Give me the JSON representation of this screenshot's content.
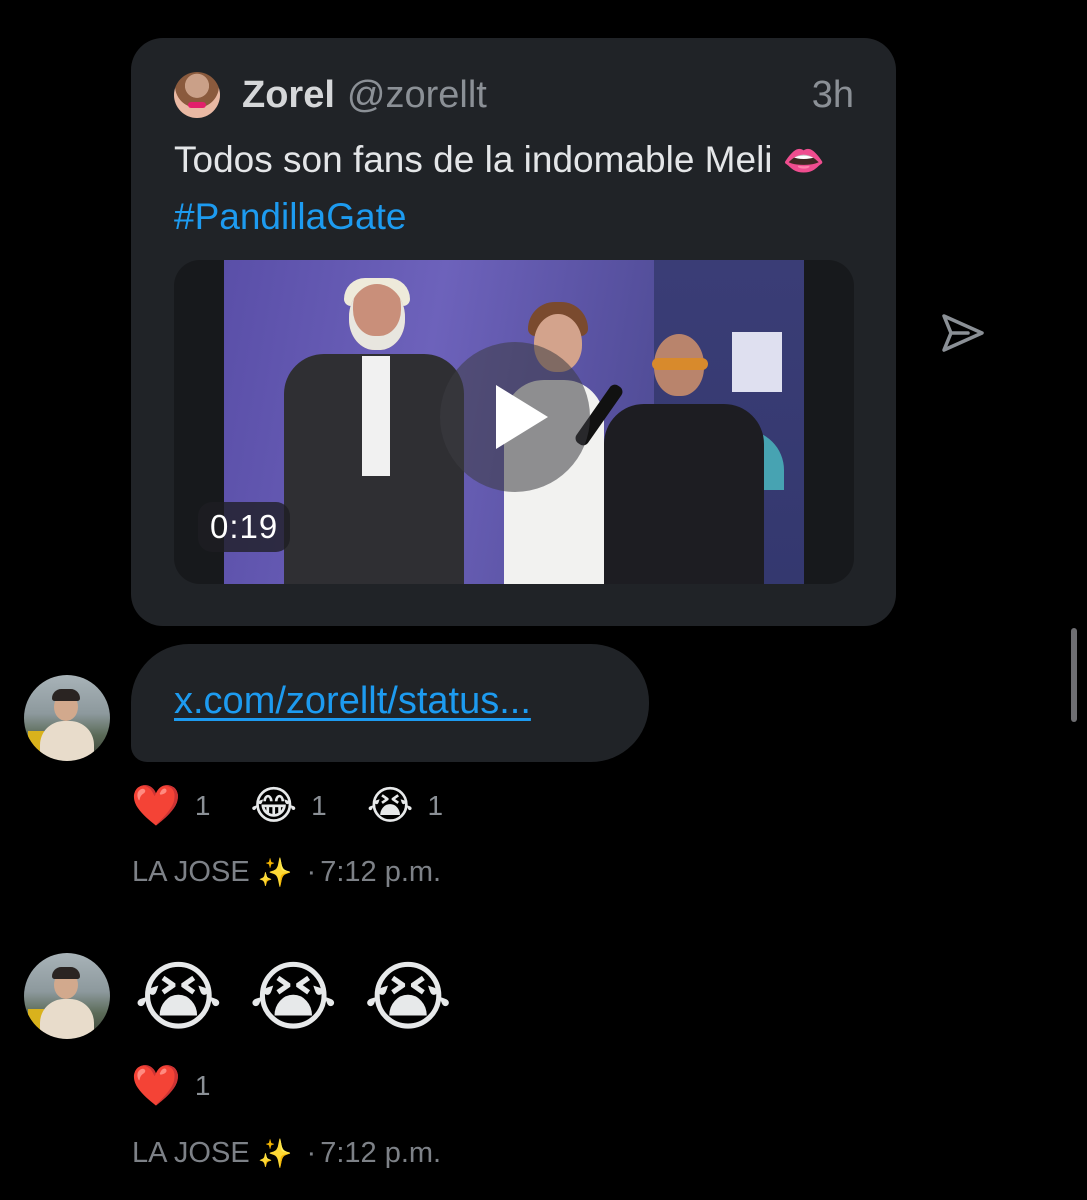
{
  "quote": {
    "name": "Zorel",
    "handle": "@zorellt",
    "time": "3h",
    "text": "Todos son fans de la indomable Meli",
    "emoji": "👄",
    "hashtag": "#PandillaGate",
    "video": {
      "duration": "0:19"
    }
  },
  "messages": [
    {
      "link": "x.com/zorellt/status...",
      "reactions": [
        {
          "emoji": "❤️",
          "count": "1"
        },
        {
          "emoji": "😂",
          "count": "1"
        },
        {
          "emoji": "😭",
          "count": "1"
        }
      ],
      "sender": "LA JOSE",
      "sender_emoji": "✨",
      "time": "7:12 p.m."
    },
    {
      "emojis": [
        "😭",
        "😭",
        "😭"
      ],
      "reactions": [
        {
          "emoji": "❤️",
          "count": "1"
        }
      ],
      "sender": "LA JOSE",
      "sender_emoji": "✨",
      "time": "7:12 p.m."
    }
  ],
  "icons": {
    "share": "send-icon",
    "play": "play-icon"
  },
  "colors": {
    "background": "#000000",
    "bubble": "#202327",
    "link": "#1d9bf0",
    "muted": "#8b9096"
  }
}
